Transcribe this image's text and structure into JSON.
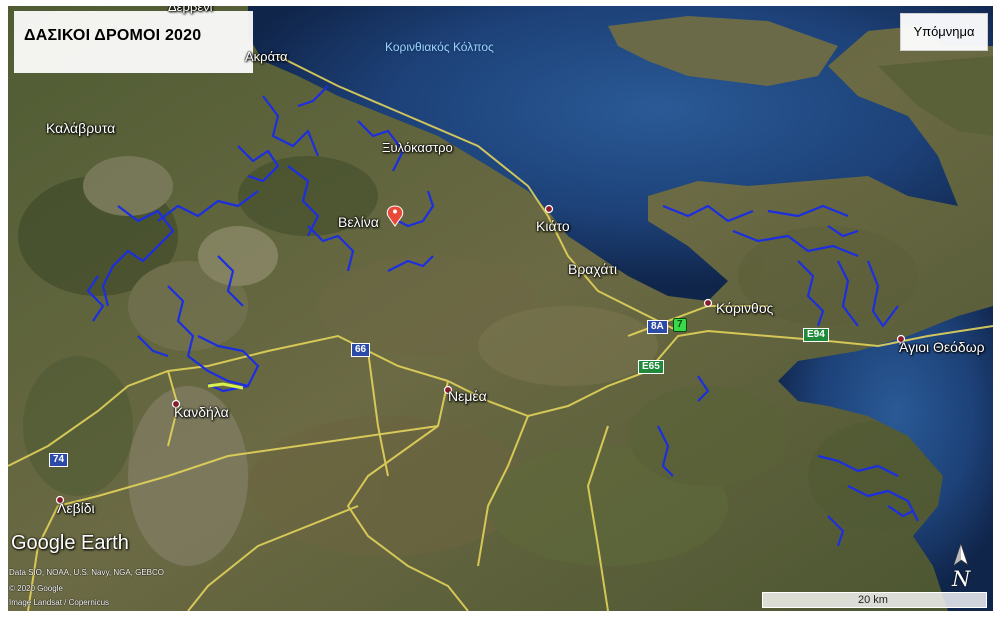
{
  "title": "ΔΑΣΙΚΟΙ ΔΡΟΜΟΙ 2020",
  "legend_button": "Υπόμνημα",
  "places": {
    "akrata": "Ακράτα",
    "kalavryta": "Καλάβρυτα",
    "xylokastro": "Ξυλόκαστρο",
    "velina": "Βελίνα",
    "kiato": "Κιάτο",
    "vrachati": "Βραχάτι",
    "korinthos": "Κόρινθος",
    "agioi_theodoroi": "Άγιοι Θεόδωρ",
    "nemea": "Νεμέα",
    "kandila": "Κανδήλα",
    "levidi": "Λεβίδι",
    "gulf": "Κορινθιακός Κόλπος",
    "top_cut": "Δερβένι"
  },
  "road_shields": {
    "r66": "66",
    "r74": "74",
    "r8a": "8A",
    "r7": "7",
    "e65": "E65",
    "e94": "E94"
  },
  "branding": {
    "wordmark": "Google Earth",
    "attrib_1": "Data SIO, NOAA, U.S. Navy, NGA, GEBCO",
    "attrib_2": "© 2020 Google",
    "attrib_3": "Image Landsat / Copernicus"
  },
  "scale_label": "20 km",
  "north_label": "N",
  "icons": [
    "placemark-pin-icon",
    "town-dot-icon",
    "north-arrow-icon",
    "landmark-icon"
  ],
  "colors": {
    "forest_roads": "#1c2fe0",
    "main_roads": "#e6d65a",
    "sea": "#1c3f78",
    "land": "#56623a"
  }
}
